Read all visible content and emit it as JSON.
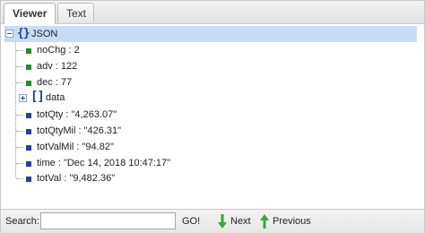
{
  "tabs": [
    {
      "label": "Viewer",
      "active": true
    },
    {
      "label": "Text",
      "active": false
    }
  ],
  "tree": {
    "root": {
      "label": "JSON",
      "expanded": true,
      "icon": "object-brace-icon"
    },
    "children": [
      {
        "label": "noChg : 2",
        "kind": "number"
      },
      {
        "label": "adv : 122",
        "kind": "number"
      },
      {
        "label": "dec : 77",
        "kind": "number"
      },
      {
        "label": "data",
        "kind": "array",
        "expanded": false
      },
      {
        "label": "totQty : \"4,263.07\"",
        "kind": "string"
      },
      {
        "label": "totQtyMil : \"426.31\"",
        "kind": "string"
      },
      {
        "label": "totValMil : \"94.82\"",
        "kind": "string"
      },
      {
        "label": "time : \"Dec 14, 2018 10:47:17\"",
        "kind": "string"
      },
      {
        "label": "totVal : \"9,482.36\"",
        "kind": "string"
      }
    ]
  },
  "search": {
    "label": "Search:",
    "value": "",
    "go_label": "GO!",
    "next_label": "Next",
    "previous_label": "Previous"
  },
  "colors": {
    "selection": "#c8ddf4",
    "number_leaf": "#1e8f2e",
    "string_leaf": "#2a3f91",
    "arrow": "#3aa63a"
  }
}
